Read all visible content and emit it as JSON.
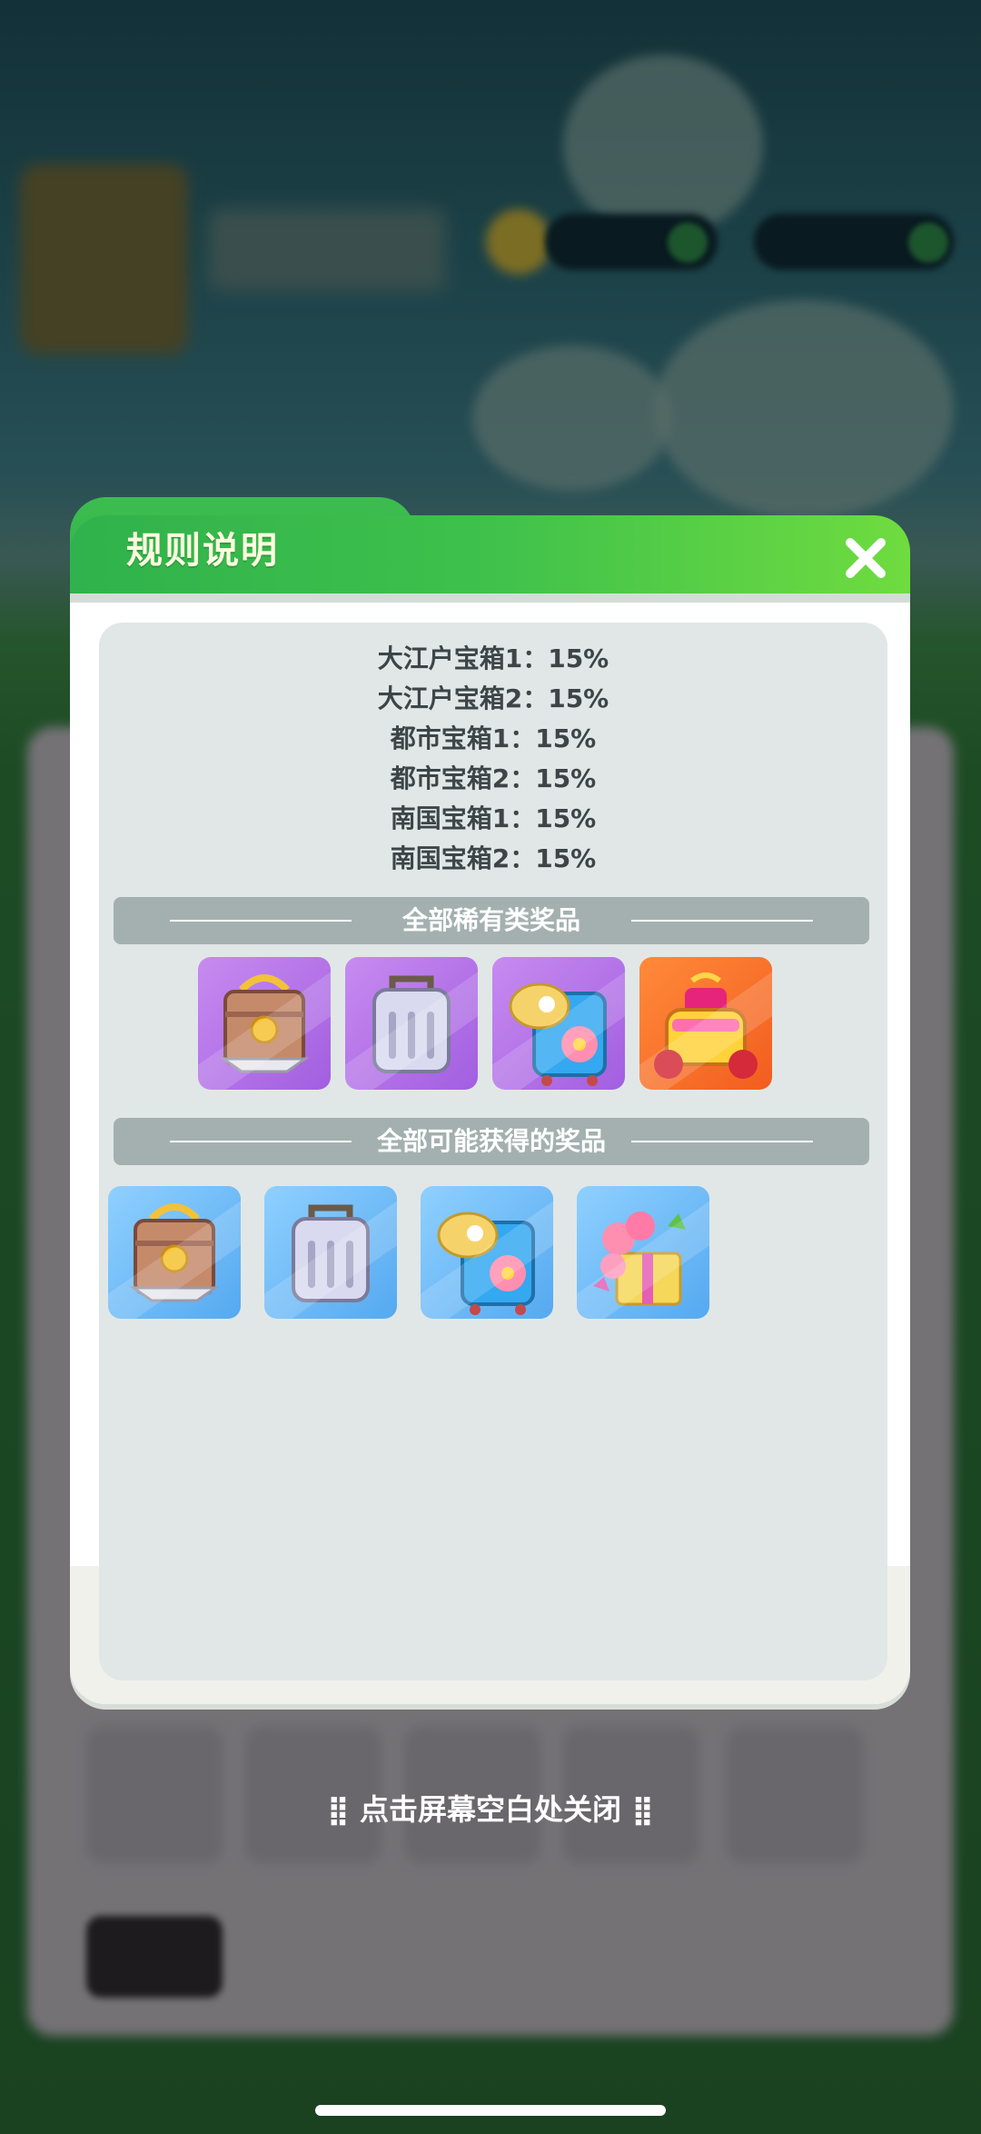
{
  "dialog": {
    "title": "规则说明",
    "close_icon": "close-icon"
  },
  "rates": [
    "大江户宝箱1：15%",
    "大江户宝箱2：15%",
    "都市宝箱1：15%",
    "都市宝箱2：15%",
    "南国宝箱1：15%",
    "南国宝箱2：15%"
  ],
  "sections": {
    "rare_title": "全部稀有类奖品",
    "all_title": "全部可能获得的奖品"
  },
  "rare_items": [
    {
      "icon": "wooden-chest-icon",
      "bg": "#b56ee8"
    },
    {
      "icon": "silver-suitcase-icon",
      "bg": "#b56ee8"
    },
    {
      "icon": "tropical-suitcase-icon",
      "bg": "#b56ee8"
    },
    {
      "icon": "samurai-helmet-chest-icon",
      "bg": "#f2662a"
    }
  ],
  "all_items": [
    {
      "icon": "wooden-chest-icon",
      "bg": "#6cb8f4"
    },
    {
      "icon": "silver-suitcase-icon",
      "bg": "#6cb8f4"
    },
    {
      "icon": "tropical-suitcase-icon",
      "bg": "#6cb8f4"
    },
    {
      "icon": "flower-gift-box-icon",
      "bg": "#6cb8f4"
    }
  ],
  "hint": "点击屏幕空白处关闭"
}
